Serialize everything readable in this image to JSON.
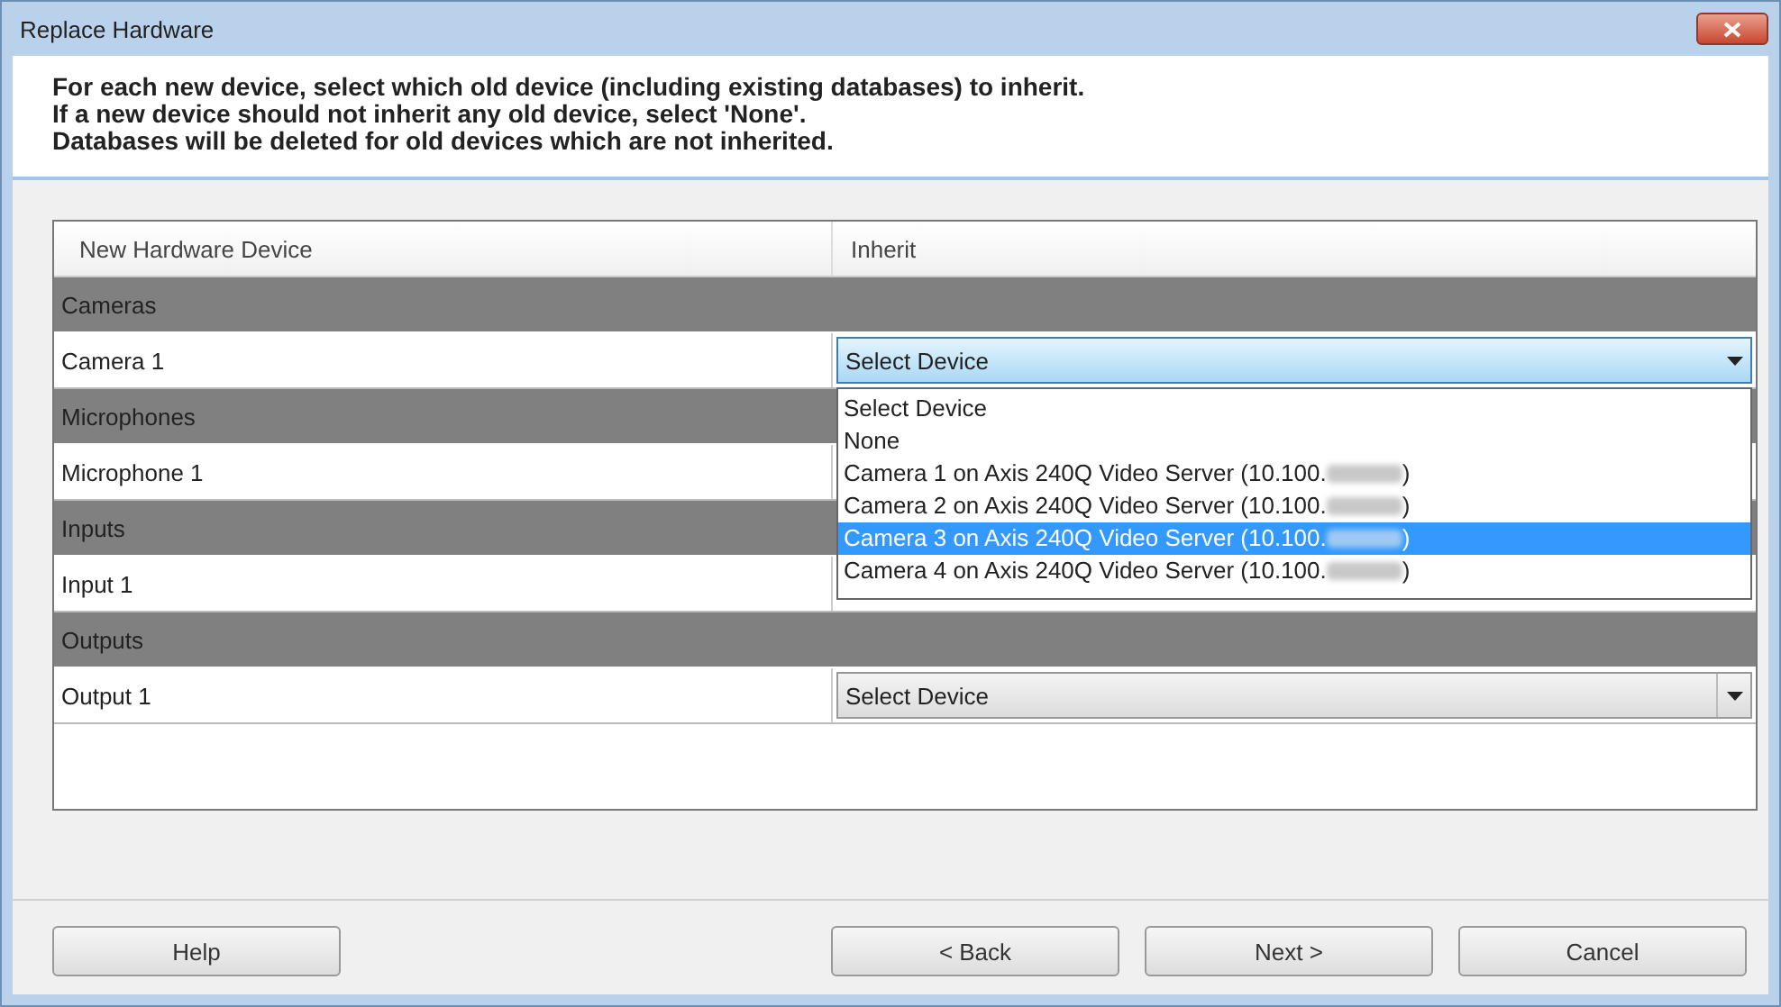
{
  "window": {
    "title": "Replace Hardware"
  },
  "instructions": [
    "For each new device, select which old device (including existing databases) to inherit.",
    "If a new device should not inherit any old device, select 'None'.",
    "Databases will be deleted for old devices which are not inherited."
  ],
  "table": {
    "columns": [
      "New Hardware Device",
      "Inherit"
    ],
    "groups": [
      {
        "label": "Cameras",
        "devices": [
          {
            "name": "Camera 1",
            "combo": {
              "value": "Select Device",
              "open": true
            }
          }
        ]
      },
      {
        "label": "Microphones",
        "devices": [
          {
            "name": "Microphone 1"
          }
        ]
      },
      {
        "label": "Inputs",
        "devices": [
          {
            "name": "Input 1"
          }
        ]
      },
      {
        "label": "Outputs",
        "devices": [
          {
            "name": "Output 1",
            "combo": {
              "value": "Select Device",
              "open": false
            }
          }
        ]
      }
    ]
  },
  "dropdown": {
    "options": [
      {
        "text": "Select Device",
        "selected": false
      },
      {
        "text": "None",
        "selected": false
      },
      {
        "text": "Camera 1 on Axis 240Q Video Server (10.100.",
        "redacted": true,
        "text_after": ")",
        "selected": false
      },
      {
        "text": "Camera 2 on Axis 240Q Video Server (10.100.",
        "redacted": true,
        "text_after": ")",
        "selected": false
      },
      {
        "text": "Camera 3 on Axis 240Q Video Server (10.100.",
        "redacted": true,
        "text_after": ")",
        "selected": true
      },
      {
        "text": "Camera 4 on Axis 240Q Video Server (10.100.",
        "redacted": true,
        "text_after": ")",
        "selected": false
      }
    ]
  },
  "buttons_left": [
    {
      "label": "Help"
    }
  ],
  "buttons_right": [
    {
      "label": "< Back"
    },
    {
      "label": "Next >"
    },
    {
      "label": "Cancel"
    }
  ]
}
